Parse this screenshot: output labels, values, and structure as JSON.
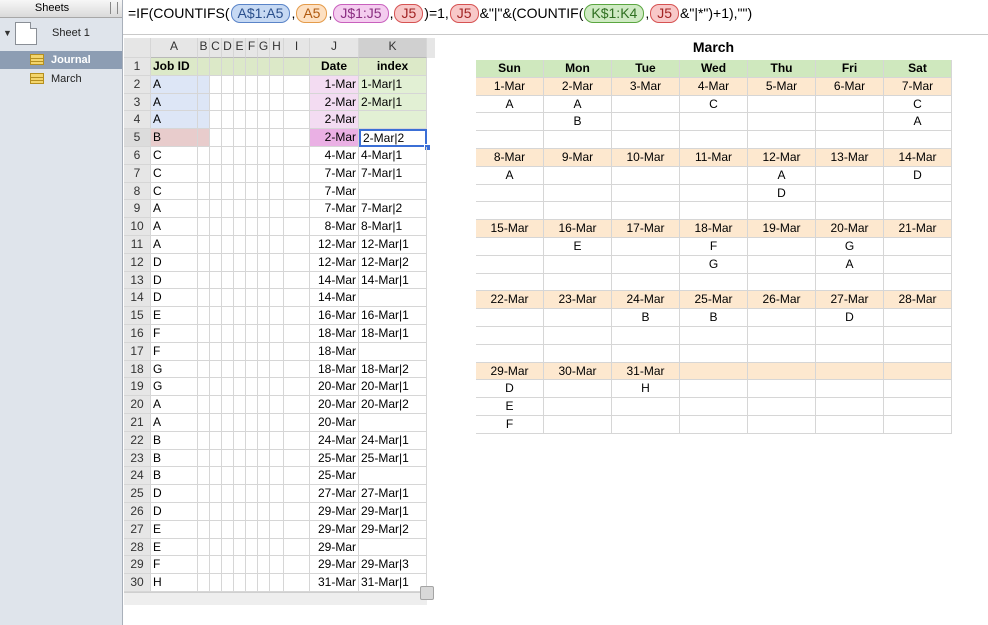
{
  "sidebar": {
    "header": "Sheets",
    "sheet_name": "Sheet 1",
    "tables": [
      {
        "label": "Journal",
        "selected": true
      },
      {
        "label": "March",
        "selected": false
      }
    ]
  },
  "formula_bar": {
    "tokens": [
      {
        "text": "=IF(COUNTIFS(",
        "style": "plain"
      },
      {
        "text": "A$1:A5",
        "style": "blue"
      },
      {
        "text": ",",
        "style": "plain"
      },
      {
        "text": "A5",
        "style": "orange"
      },
      {
        "text": ",",
        "style": "plain"
      },
      {
        "text": "J$1:J5",
        "style": "pink"
      },
      {
        "text": ",",
        "style": "plain"
      },
      {
        "text": "J5",
        "style": "red"
      },
      {
        "text": ")=1,",
        "style": "plain"
      },
      {
        "text": "J5",
        "style": "red"
      },
      {
        "text": "&\"|\"&(COUNTIF(",
        "style": "plain"
      },
      {
        "text": "K$1:K4",
        "style": "green"
      },
      {
        "text": ",",
        "style": "plain"
      },
      {
        "text": "J5",
        "style": "red"
      },
      {
        "text": "&\"|*\")+1),\"\")",
        "style": "plain"
      }
    ]
  },
  "journal": {
    "columns": [
      "A",
      "B",
      "C",
      "D",
      "E",
      "F",
      "G",
      "H",
      "I",
      "J",
      "K"
    ],
    "header": {
      "job_id": "Job ID",
      "date": "Date",
      "index": "index"
    },
    "rows": [
      {
        "job": "A",
        "date": "1-Mar",
        "index": "1-Mar|1"
      },
      {
        "job": "A",
        "date": "2-Mar",
        "index": "2-Mar|1"
      },
      {
        "job": "A",
        "date": "2-Mar",
        "index": ""
      },
      {
        "job": "B",
        "date": "2-Mar",
        "index": "2-Mar|2"
      },
      {
        "job": "C",
        "date": "4-Mar",
        "index": "4-Mar|1"
      },
      {
        "job": "C",
        "date": "7-Mar",
        "index": "7-Mar|1"
      },
      {
        "job": "C",
        "date": "7-Mar",
        "index": ""
      },
      {
        "job": "A",
        "date": "7-Mar",
        "index": "7-Mar|2"
      },
      {
        "job": "A",
        "date": "8-Mar",
        "index": "8-Mar|1"
      },
      {
        "job": "A",
        "date": "12-Mar",
        "index": "12-Mar|1"
      },
      {
        "job": "D",
        "date": "12-Mar",
        "index": "12-Mar|2"
      },
      {
        "job": "D",
        "date": "14-Mar",
        "index": "14-Mar|1"
      },
      {
        "job": "D",
        "date": "14-Mar",
        "index": ""
      },
      {
        "job": "E",
        "date": "16-Mar",
        "index": "16-Mar|1"
      },
      {
        "job": "F",
        "date": "18-Mar",
        "index": "18-Mar|1"
      },
      {
        "job": "F",
        "date": "18-Mar",
        "index": ""
      },
      {
        "job": "G",
        "date": "18-Mar",
        "index": "18-Mar|2"
      },
      {
        "job": "G",
        "date": "20-Mar",
        "index": "20-Mar|1"
      },
      {
        "job": "A",
        "date": "20-Mar",
        "index": "20-Mar|2"
      },
      {
        "job": "A",
        "date": "20-Mar",
        "index": ""
      },
      {
        "job": "B",
        "date": "24-Mar",
        "index": "24-Mar|1"
      },
      {
        "job": "B",
        "date": "25-Mar",
        "index": "25-Mar|1"
      },
      {
        "job": "B",
        "date": "25-Mar",
        "index": ""
      },
      {
        "job": "D",
        "date": "27-Mar",
        "index": "27-Mar|1"
      },
      {
        "job": "D",
        "date": "29-Mar",
        "index": "29-Mar|1"
      },
      {
        "job": "E",
        "date": "29-Mar",
        "index": "29-Mar|2"
      },
      {
        "job": "E",
        "date": "29-Mar",
        "index": ""
      },
      {
        "job": "F",
        "date": "29-Mar",
        "index": "29-Mar|3"
      },
      {
        "job": "H",
        "date": "31-Mar",
        "index": "31-Mar|1"
      }
    ]
  },
  "calendar": {
    "title": "March",
    "days": [
      "Sun",
      "Mon",
      "Tue",
      "Wed",
      "Thu",
      "Fri",
      "Sat"
    ],
    "weeks": [
      {
        "dates": [
          "1-Mar",
          "2-Mar",
          "3-Mar",
          "4-Mar",
          "5-Mar",
          "6-Mar",
          "7-Mar"
        ],
        "jobs": [
          [
            "A",
            "A",
            "",
            "C",
            "",
            "",
            "C"
          ],
          [
            "",
            "B",
            "",
            "",
            "",
            "",
            "A"
          ],
          [
            "",
            "",
            "",
            "",
            "",
            "",
            ""
          ]
        ]
      },
      {
        "dates": [
          "8-Mar",
          "9-Mar",
          "10-Mar",
          "11-Mar",
          "12-Mar",
          "13-Mar",
          "14-Mar"
        ],
        "jobs": [
          [
            "A",
            "",
            "",
            "",
            "A",
            "",
            "D"
          ],
          [
            "",
            "",
            "",
            "",
            "D",
            "",
            ""
          ],
          [
            "",
            "",
            "",
            "",
            "",
            "",
            ""
          ]
        ]
      },
      {
        "dates": [
          "15-Mar",
          "16-Mar",
          "17-Mar",
          "18-Mar",
          "19-Mar",
          "20-Mar",
          "21-Mar"
        ],
        "jobs": [
          [
            "",
            "E",
            "",
            "F",
            "",
            "G",
            ""
          ],
          [
            "",
            "",
            "",
            "G",
            "",
            "A",
            ""
          ],
          [
            "",
            "",
            "",
            "",
            "",
            "",
            ""
          ]
        ]
      },
      {
        "dates": [
          "22-Mar",
          "23-Mar",
          "24-Mar",
          "25-Mar",
          "26-Mar",
          "27-Mar",
          "28-Mar"
        ],
        "jobs": [
          [
            "",
            "",
            "B",
            "B",
            "",
            "D",
            ""
          ],
          [
            "",
            "",
            "",
            "",
            "",
            "",
            ""
          ],
          [
            "",
            "",
            "",
            "",
            "",
            "",
            ""
          ]
        ]
      },
      {
        "dates": [
          "29-Mar",
          "30-Mar",
          "31-Mar",
          "",
          "",
          "",
          ""
        ],
        "jobs": [
          [
            "D",
            "",
            "H",
            "",
            "",
            "",
            ""
          ],
          [
            "E",
            "",
            "",
            "",
            "",
            "",
            ""
          ],
          [
            "F",
            "",
            "",
            "",
            "",
            "",
            ""
          ]
        ]
      }
    ]
  }
}
